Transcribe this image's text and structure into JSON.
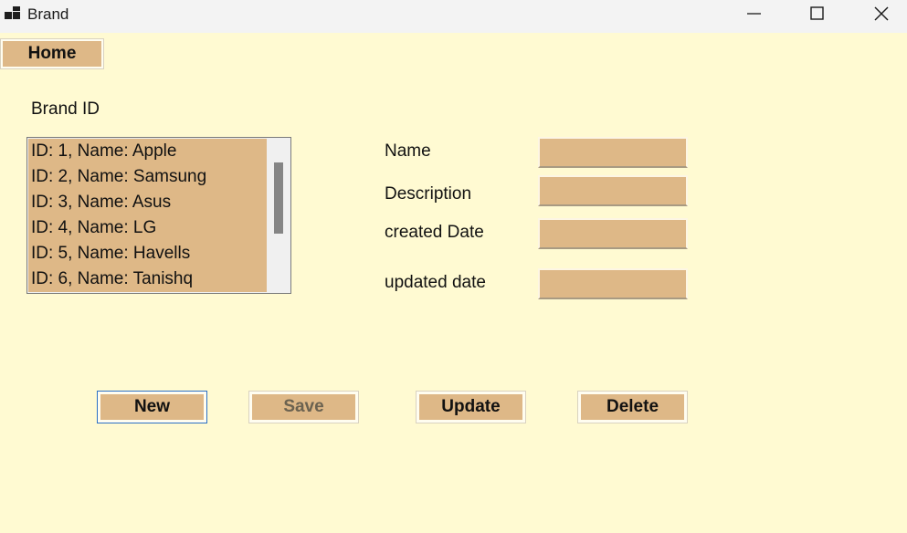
{
  "window": {
    "title": "Brand",
    "background": "#fffad2",
    "accent": "#deb887"
  },
  "nav": {
    "home_label": "Home"
  },
  "brand_id": {
    "label": "Brand ID",
    "items": [
      "ID: 1, Name: Apple",
      "ID: 2, Name: Samsung",
      "ID: 3, Name: Asus",
      "ID: 4, Name: LG",
      "ID: 5, Name: Havells",
      "ID: 6, Name: Tanishq"
    ]
  },
  "form": {
    "name_label": "Name",
    "name_value": "",
    "description_label": "Description",
    "description_value": "",
    "created_label": "created Date",
    "created_value": "",
    "updated_label": "updated date",
    "updated_value": ""
  },
  "actions": {
    "new_label": "New",
    "save_label": "Save",
    "update_label": "Update",
    "delete_label": "Delete"
  },
  "icons": {
    "app": "app-icon",
    "minimize": "minimize-icon",
    "maximize": "maximize-icon",
    "close": "close-icon"
  }
}
